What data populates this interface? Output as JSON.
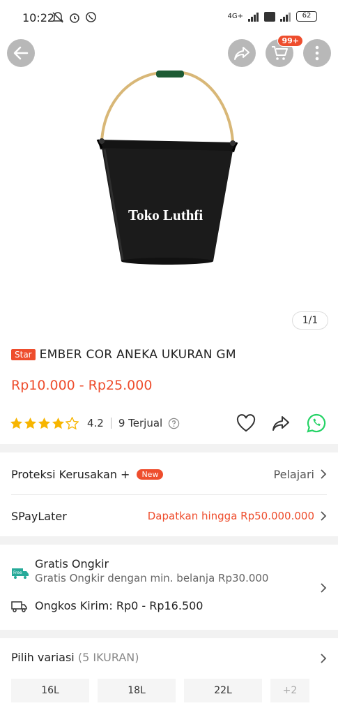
{
  "status_bar": {
    "time": "10:22",
    "battery": "62",
    "network": "4G+"
  },
  "header": {
    "cart_badge": "99+"
  },
  "product": {
    "image_caption": "Toko Luthfi",
    "image_counter": "1/1",
    "badge": "Star",
    "title": "EMBER COR ANEKA UKURAN GM",
    "price_range": "Rp10.000 - Rp25.000",
    "rating": "4.2",
    "rating_stars_filled": 4.2,
    "sold": "9 Terjual"
  },
  "protection": {
    "label": "Proteksi Kerusakan +",
    "badge": "New",
    "action": "Pelajari"
  },
  "paylater": {
    "label": "SPayLater",
    "offer": "Dapatkan hingga Rp50.000.000"
  },
  "shipping": {
    "free_title": "Gratis Ongkir",
    "free_sub": "Gratis Ongkir dengan min. belanja Rp30.000",
    "free_icon_text": "Free",
    "cost": "Ongkos Kirim: Rp0 - Rp16.500"
  },
  "variants": {
    "title": "Pilih variasi",
    "count": "(5 IKURAN)",
    "options": [
      "16L",
      "18L",
      "22L"
    ],
    "more": "+2"
  },
  "colors": {
    "accent": "#ee4d2d",
    "whatsapp": "#25d366",
    "star": "#f7b500"
  }
}
